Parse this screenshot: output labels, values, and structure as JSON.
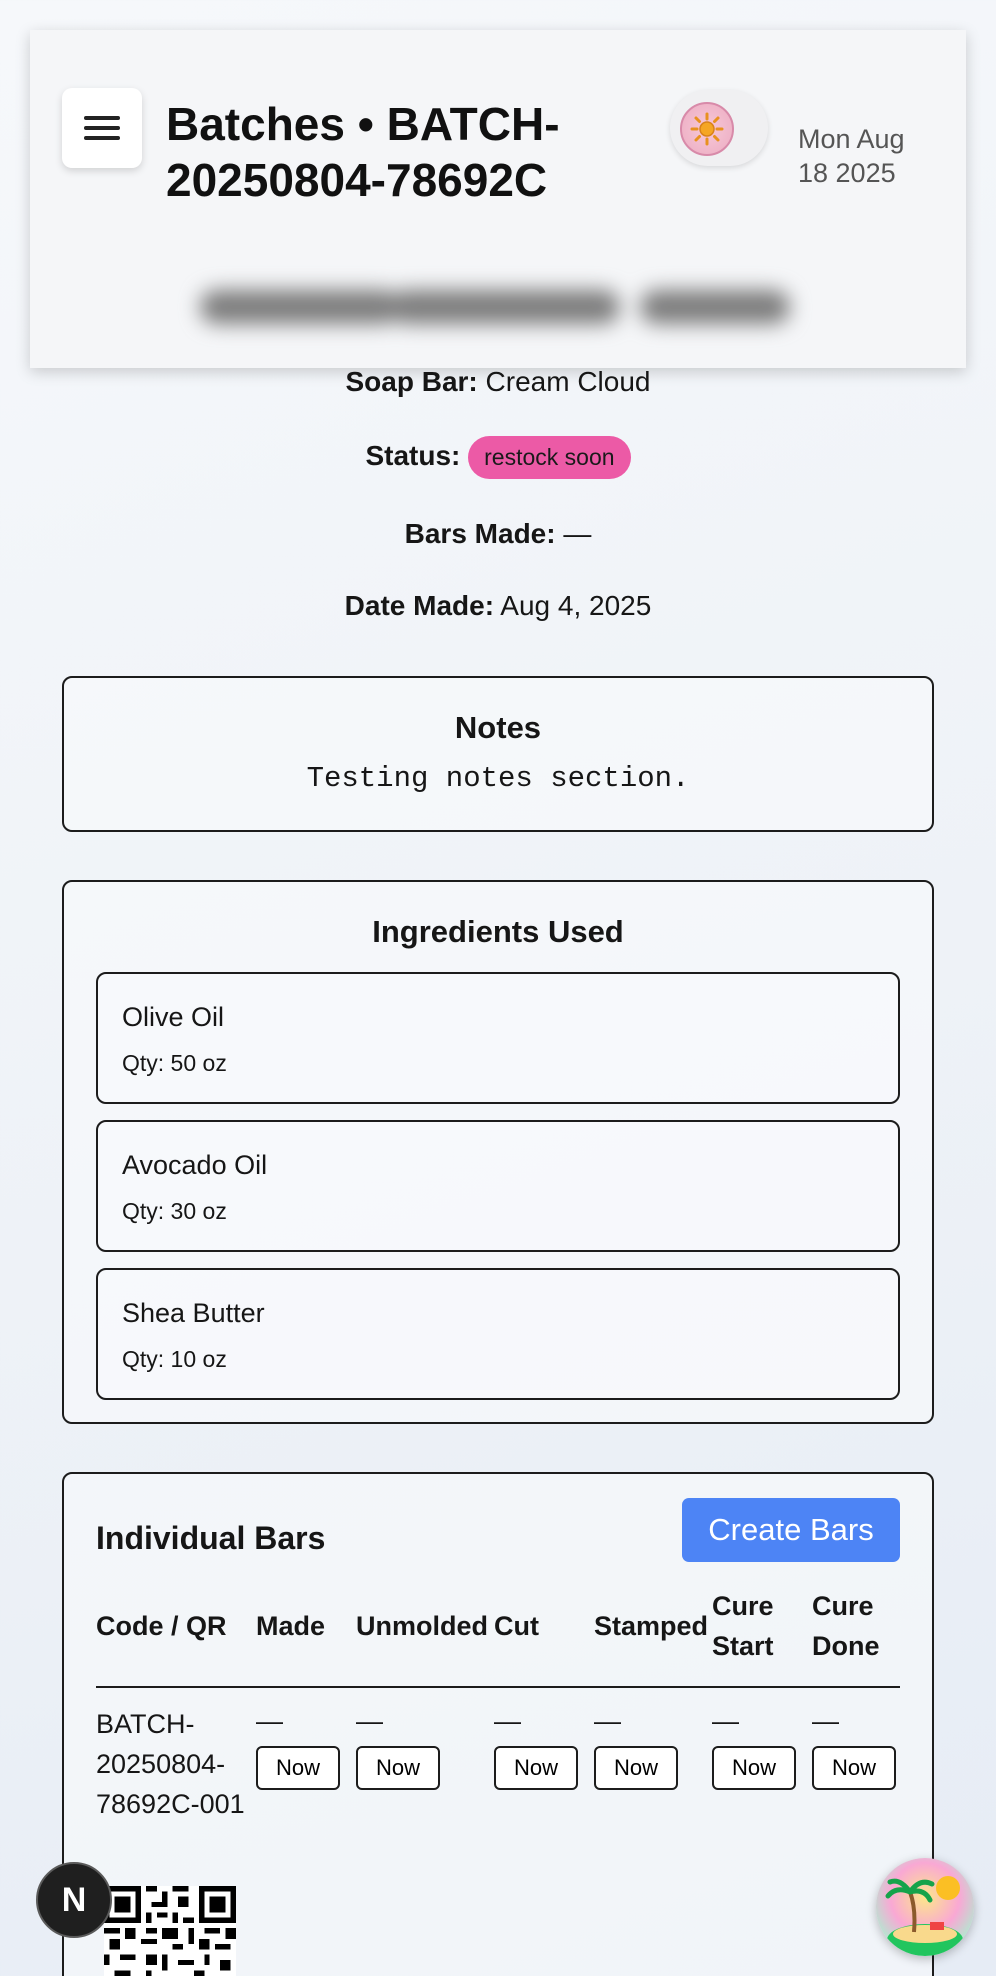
{
  "header": {
    "title": "Batches • BATCH-20250804-78692C",
    "date": "Mon Aug 18 2025"
  },
  "details": {
    "soap_bar_label": "Soap Bar:",
    "soap_bar_value": "Cream Cloud",
    "status_label": "Status:",
    "status_value": "restock soon",
    "bars_made_label": "Bars Made:",
    "bars_made_value": "—",
    "date_made_label": "Date Made:",
    "date_made_value": "Aug 4, 2025"
  },
  "notes": {
    "title": "Notes",
    "text": "Testing notes section."
  },
  "ingredients": {
    "title": "Ingredients Used",
    "items": [
      {
        "name": "Olive Oil",
        "qty": "Qty: 50 oz"
      },
      {
        "name": "Avocado Oil",
        "qty": "Qty: 30 oz"
      },
      {
        "name": "Shea Butter",
        "qty": "Qty: 10 oz"
      }
    ]
  },
  "bars": {
    "title": "Individual Bars",
    "create_label": "Create Bars",
    "columns": [
      "Code / QR",
      "Made",
      "Unmolded",
      "Cut",
      "Stamped",
      "Cure Start",
      "Cure Done"
    ],
    "rows": [
      {
        "code": "BATCH-20250804-78692C-001",
        "values": [
          "—",
          "—",
          "—",
          "—",
          "—",
          "—"
        ],
        "action_label": "Now"
      }
    ]
  },
  "fab": {
    "n_label": "N"
  },
  "colors": {
    "status": "#ec5aa6",
    "primary": "#4d84f5"
  }
}
